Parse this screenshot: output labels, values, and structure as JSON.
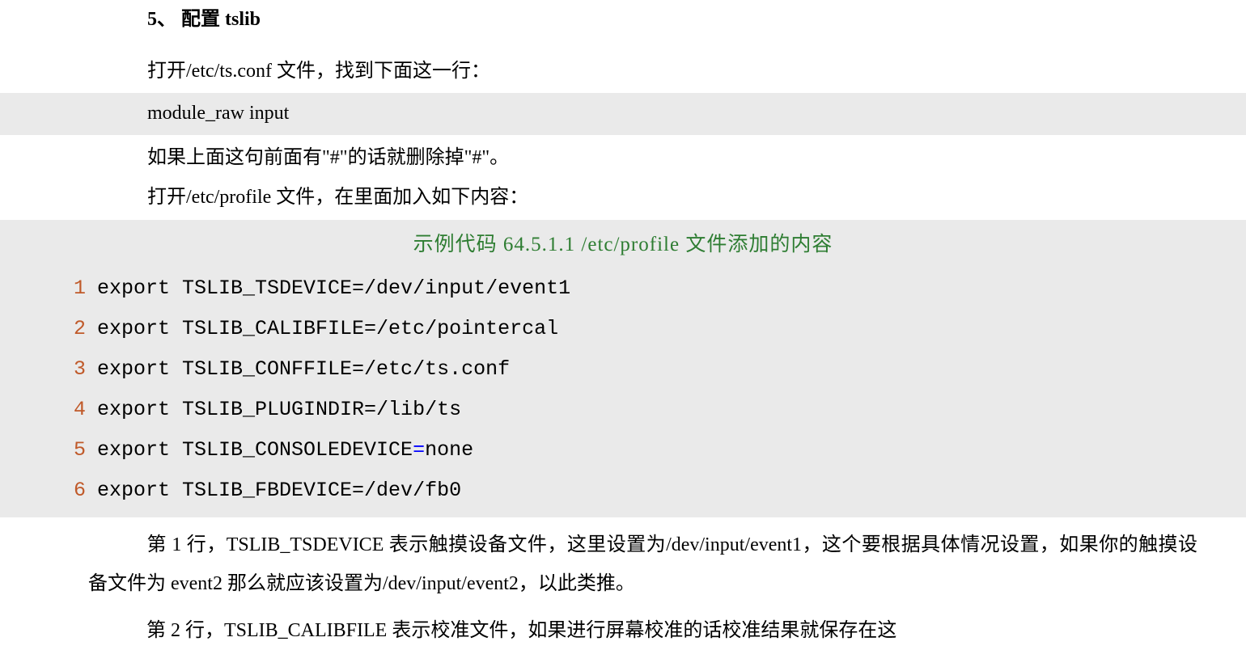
{
  "section": {
    "number": "5、",
    "title": "配置 tslib"
  },
  "para1": "打开/etc/ts.conf 文件，找到下面这一行：",
  "highlight1": "module_raw input",
  "para2": "如果上面这句前面有\"#\"的话就删除掉\"#\"。",
  "para3": "打开/etc/profile 文件，在里面加入如下内容：",
  "code_caption": "示例代码 64.5.1.1 /etc/profile 文件添加的内容",
  "code_lines": [
    {
      "n": "1",
      "t": "export TSLIB_TSDEVICE=/dev/input/event1"
    },
    {
      "n": "2",
      "t": "export TSLIB_CALIBFILE=/etc/pointercal"
    },
    {
      "n": "3",
      "t": "export TSLIB_CONFFILE=/etc/ts.conf"
    },
    {
      "n": "4",
      "t": "export TSLIB_PLUGINDIR=/lib/ts"
    },
    {
      "n": "5",
      "t_pre": "export TSLIB_CONSOLEDEVICE",
      "eq": "=",
      "t_post": "none"
    },
    {
      "n": "6",
      "t": "export TSLIB_FBDEVICE=/dev/fb0"
    }
  ],
  "body1_a": "第 1 行，TSLIB_TSDEVICE 表示触摸设备文件，这里设置为/dev/input/event1，这个要根据具体情况设置，如果你的触摸设备文件为 event2 那么就应该设置为/dev/input/event2，以此类推。",
  "body2_a": "第 2 行，TSLIB_CALIBFILE 表示校准文件，如果进行屏幕校准的话校准结果就保存在这"
}
